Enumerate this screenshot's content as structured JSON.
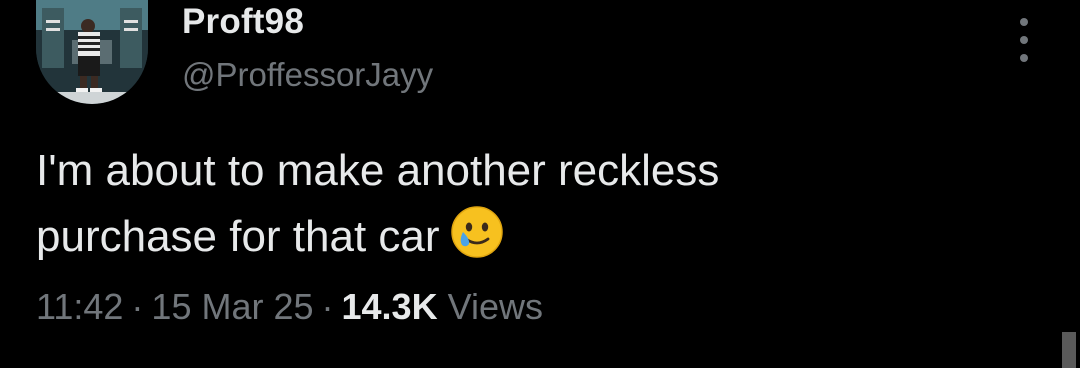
{
  "author": {
    "display_name": "Proft98",
    "handle": "@ProffessorJayy"
  },
  "tweet": {
    "text": "I'm about to make another reckless\npurchase for that car",
    "emoji": "face-holding-back-tears-icon"
  },
  "meta": {
    "time": "11:42",
    "date": "15 Mar 25",
    "separator": "·",
    "views_count": "14.3K",
    "views_label": "Views"
  },
  "icons": {
    "more": "more-options-icon"
  },
  "colors": {
    "background": "#000000",
    "primary_text": "#e7e9ea",
    "secondary_text": "#71767b"
  }
}
